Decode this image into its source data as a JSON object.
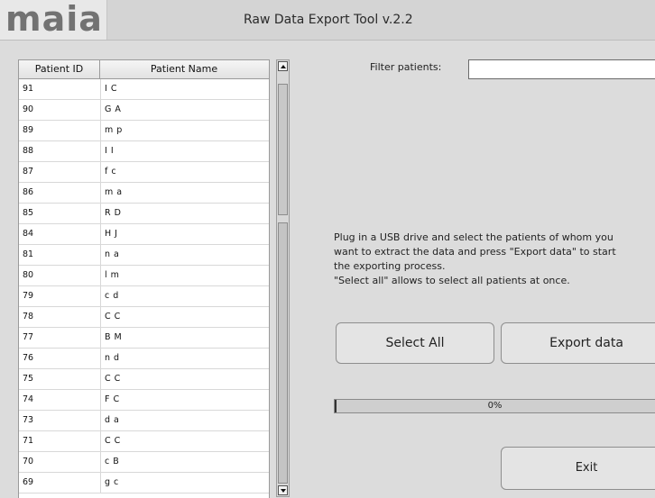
{
  "header": {
    "logo_text": "maia",
    "title": "Raw Data Export Tool v.2.2"
  },
  "table": {
    "columns": [
      "Patient ID",
      "Patient Name"
    ],
    "rows": [
      {
        "id": "91",
        "name": "I C"
      },
      {
        "id": "90",
        "name": "G A"
      },
      {
        "id": "89",
        "name": "m p"
      },
      {
        "id": "88",
        "name": "I I"
      },
      {
        "id": "87",
        "name": "f c"
      },
      {
        "id": "86",
        "name": "m a"
      },
      {
        "id": "85",
        "name": "R D"
      },
      {
        "id": "84",
        "name": "H J"
      },
      {
        "id": "81",
        "name": "n a"
      },
      {
        "id": "80",
        "name": "l m"
      },
      {
        "id": "79",
        "name": "c d"
      },
      {
        "id": "78",
        "name": "C C"
      },
      {
        "id": "77",
        "name": "B M"
      },
      {
        "id": "76",
        "name": "n d"
      },
      {
        "id": "75",
        "name": "C C"
      },
      {
        "id": "74",
        "name": "F C"
      },
      {
        "id": "73",
        "name": "d a"
      },
      {
        "id": "71",
        "name": "C C"
      },
      {
        "id": "70",
        "name": "c B"
      },
      {
        "id": "69",
        "name": "g c"
      }
    ]
  },
  "filter": {
    "label": "Filter patients:",
    "value": ""
  },
  "info": {
    "line1": "Plug in a USB drive and select the patients of whom you",
    "line2": "want to extract the data and press \"Export data\" to start",
    "line3": "the exporting process.",
    "line4": "\"Select all\" allows to select all patients at once."
  },
  "buttons": {
    "select_all": "Select All",
    "export": "Export data",
    "exit": "Exit"
  },
  "progress": {
    "text": "0%",
    "value": 0
  },
  "icons": {
    "scroll_up": "arrow-up-icon",
    "scroll_down": "arrow-down-icon"
  },
  "colors": {
    "background": "#dcdcdc",
    "progress_fill": "#3a8adc"
  }
}
